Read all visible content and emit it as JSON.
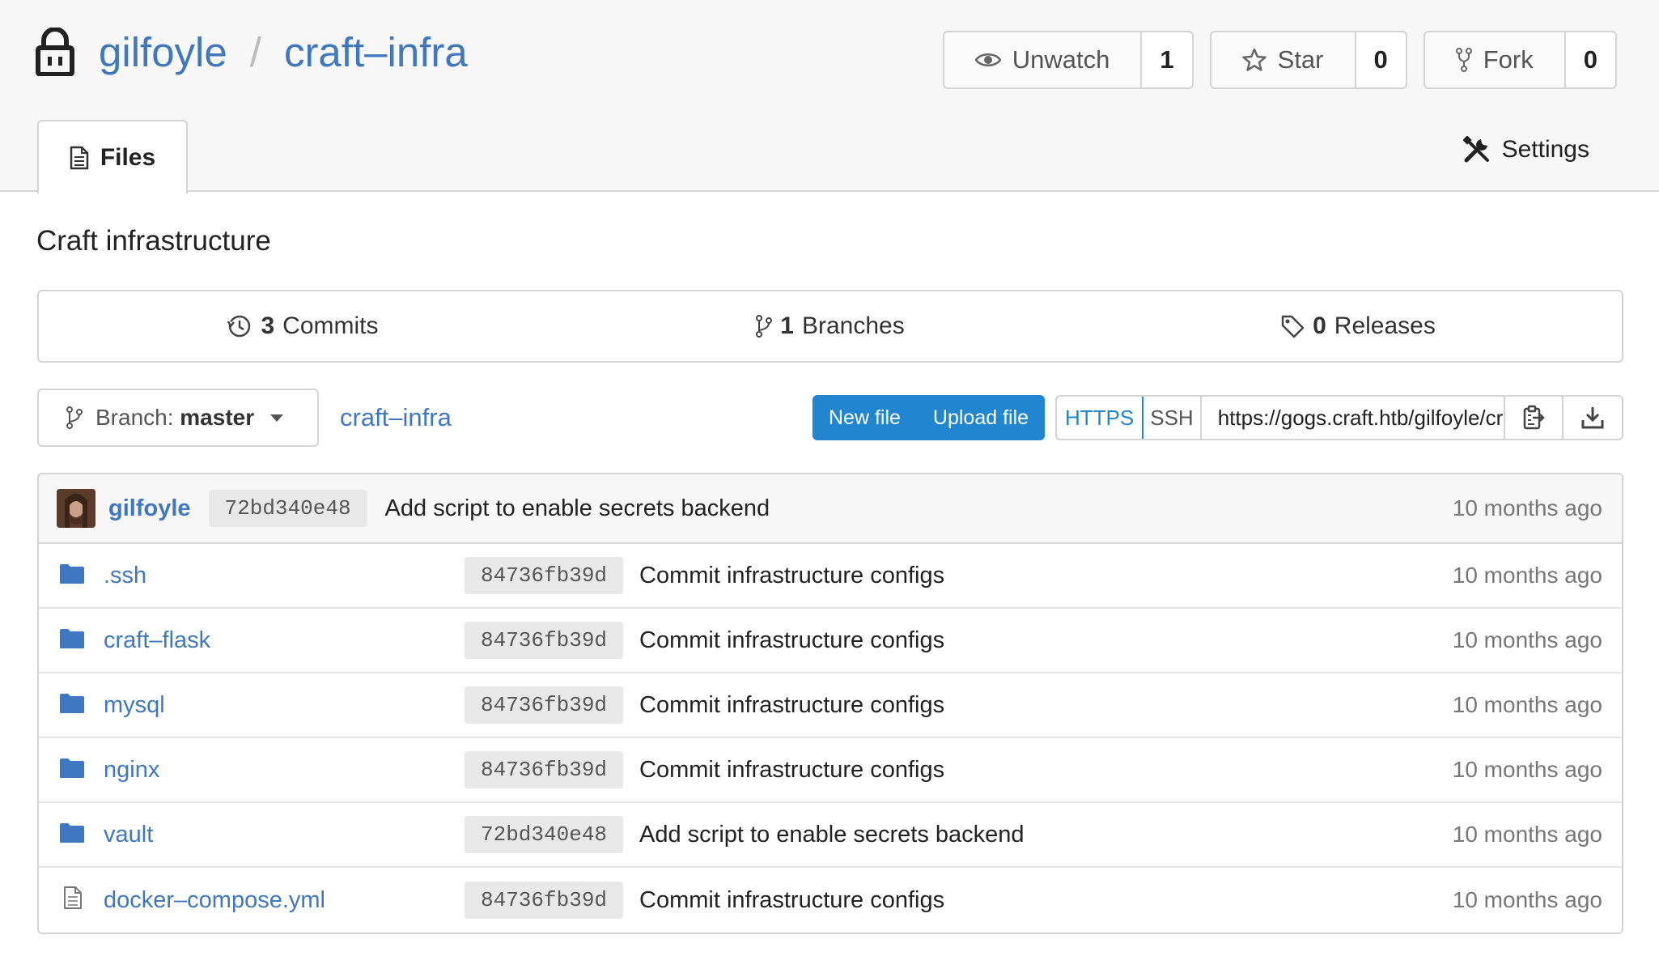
{
  "header": {
    "owner": "gilfoyle",
    "separator": "/",
    "repo": "craft–infra",
    "watch": {
      "label": "Unwatch",
      "count": "1"
    },
    "star": {
      "label": "Star",
      "count": "0"
    },
    "fork": {
      "label": "Fork",
      "count": "0"
    }
  },
  "tabs": {
    "files": "Files",
    "settings": "Settings"
  },
  "description": "Craft infrastructure",
  "stats": {
    "commits": {
      "count": "3",
      "label": "Commits"
    },
    "branches": {
      "count": "1",
      "label": "Branches"
    },
    "releases": {
      "count": "0",
      "label": "Releases"
    }
  },
  "toolbar": {
    "branch_prefix": "Branch:",
    "branch_name": "master",
    "breadcrumb": "craft–infra",
    "new_file": "New file",
    "upload_file": "Upload file",
    "https": "HTTPS",
    "ssh": "SSH",
    "clone_url": "https://gogs.craft.htb/gilfoyle/craft-infra.git"
  },
  "latest_commit": {
    "author": "gilfoyle",
    "sha": "72bd340e48",
    "message": "Add script to enable secrets backend",
    "age": "10 months ago"
  },
  "files": [
    {
      "name": ".ssh",
      "type": "folder",
      "sha": "84736fb39d",
      "message": "Commit infrastructure configs",
      "age": "10 months ago"
    },
    {
      "name": "craft–flask",
      "type": "folder",
      "sha": "84736fb39d",
      "message": "Commit infrastructure configs",
      "age": "10 months ago"
    },
    {
      "name": "mysql",
      "type": "folder",
      "sha": "84736fb39d",
      "message": "Commit infrastructure configs",
      "age": "10 months ago"
    },
    {
      "name": "nginx",
      "type": "folder",
      "sha": "84736fb39d",
      "message": "Commit infrastructure configs",
      "age": "10 months ago"
    },
    {
      "name": "vault",
      "type": "folder",
      "sha": "72bd340e48",
      "message": "Add script to enable secrets backend",
      "age": "10 months ago"
    },
    {
      "name": "docker–compose.yml",
      "type": "file",
      "sha": "84736fb39d",
      "message": "Commit infrastructure configs",
      "age": "10 months ago"
    }
  ],
  "colors": {
    "link": "#4078c0",
    "primary": "#2185d0",
    "header_bg": "#f7f7f7"
  }
}
